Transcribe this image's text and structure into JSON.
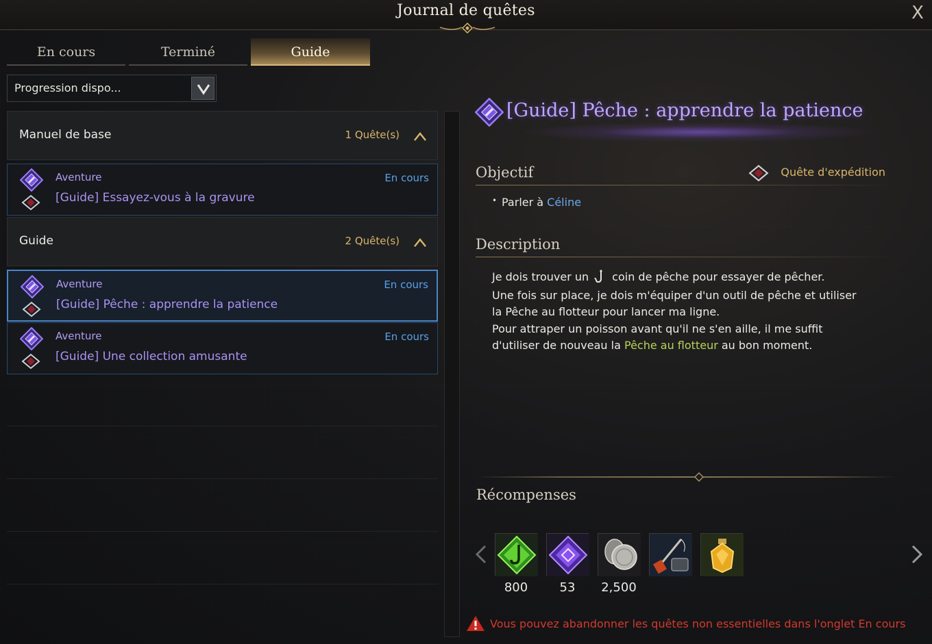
{
  "window": {
    "title": "Journal de quêtes",
    "close_label": "X"
  },
  "tabs": [
    {
      "label": "En cours"
    },
    {
      "label": "Terminé"
    },
    {
      "label": "Guide",
      "active": true
    }
  ],
  "filter": {
    "selected": "Progression dispo..."
  },
  "groups": [
    {
      "name": "Manuel de base",
      "count": "1 Quête(s)",
      "quests": [
        {
          "category": "Aventure",
          "status": "En cours",
          "title": "[Guide] Essayez-vous à la gravure"
        }
      ]
    },
    {
      "name": "Guide",
      "count": "2 Quête(s)",
      "quests": [
        {
          "category": "Aventure",
          "status": "En cours",
          "title": "[Guide] Pêche : apprendre la patience",
          "selected": true
        },
        {
          "category": "Aventure",
          "status": "En cours",
          "title": "[Guide] Une collection amusante"
        }
      ]
    }
  ],
  "detail": {
    "title": "[Guide] Pêche : apprendre la patience",
    "objective_header": "Objectif",
    "quest_type": "Quête d'expédition",
    "objective": {
      "prefix": "Parler à ",
      "npc": "Céline"
    },
    "description_header": "Description",
    "description": {
      "line1_a": "Je dois trouver un",
      "line1_b": "coin de pêche pour essayer de pêcher.",
      "line2": "Une fois sur place, je dois m'équiper d'un outil de pêche et utiliser",
      "line3": "la Pêche au flotteur pour lancer ma ligne.",
      "line4": "Pour attraper un poisson avant qu'il ne s'en aille, il me suffit",
      "line5_a": "d'utiliser de nouveau la ",
      "line5_kw": "Pêche au flotteur",
      "line5_b": " au bon moment."
    },
    "rewards_header": "Récompenses",
    "rewards": [
      {
        "icon": "green-fishing-hook-gem-icon",
        "count": "800"
      },
      {
        "icon": "purple-gem-icon",
        "count": "53"
      },
      {
        "icon": "silver-coins-icon",
        "count": "2,500"
      },
      {
        "icon": "fishing-rod-kit-icon",
        "count": ""
      },
      {
        "icon": "golden-potion-icon",
        "count": ""
      }
    ],
    "warning": "Vous pouvez abandonner les quêtes non essentielles dans l'onglet En cours"
  },
  "colors": {
    "accent_gold": "#d8b56b",
    "quest_purple": "#ab92f0",
    "status_blue": "#5aa0e8",
    "keyword_green": "#b8d25a",
    "warning_red": "#d23a2e"
  }
}
